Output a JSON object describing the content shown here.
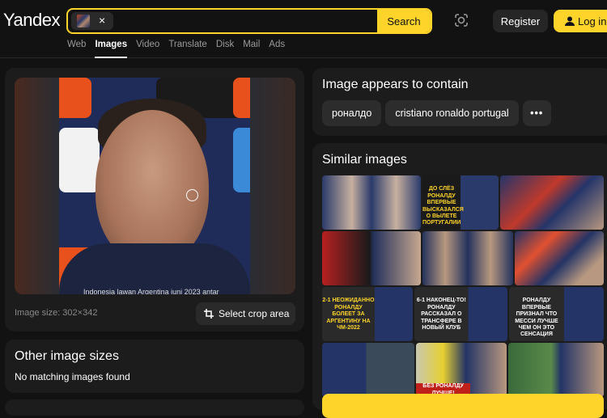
{
  "header": {
    "logo": "Yandex",
    "search_button": "Search",
    "chip_close": "×",
    "register": "Register",
    "login": "Log in"
  },
  "nav": {
    "items": [
      {
        "label": "Web",
        "active": false
      },
      {
        "label": "Images",
        "active": true
      },
      {
        "label": "Video",
        "active": false
      },
      {
        "label": "Translate",
        "active": false
      },
      {
        "label": "Disk",
        "active": false
      },
      {
        "label": "Mail",
        "active": false
      },
      {
        "label": "Ads",
        "active": false
      }
    ]
  },
  "preview": {
    "caption": "Indonesia lawan Argentina juni 2023 antar",
    "image_size": "Image size: 302×342",
    "crop_button": "Select crop area"
  },
  "other_sizes": {
    "title": "Other image sizes",
    "message": "No matching images found"
  },
  "contains": {
    "title": "Image appears to contain",
    "tags": [
      "роналдо",
      "cristiano ronaldo portugal"
    ],
    "more": "•••"
  },
  "similar": {
    "title": "Similar images",
    "rows": [
      [
        {
          "text": "",
          "color": "#2a3a6a"
        },
        {
          "text": "ДО СЛЁЗ РОНАЛДУ ВПЕРВЫЕ ВЫСКАЗАЛСЯ О ВЫЛЕТЕ ПОРТУГАЛИИ",
          "color": "#1a1a1a"
        },
        {
          "text": "",
          "color": "#25356a"
        }
      ],
      [
        {
          "text": "",
          "color": "#2a2f4a"
        },
        {
          "text": "",
          "color": "#24325c"
        },
        {
          "text": "",
          "color": "#243466"
        }
      ],
      [
        {
          "text": "2-1 НЕОЖИДАННО РОНАЛДУ БОЛЕЕТ ЗА АРГЕНТИНУ НА ЧМ-2022",
          "color": "#2a2a2a"
        },
        {
          "text": "6-1 НАКОНЕЦ-ТО! РОНАЛДУ РАССКАЗАЛ О ТРАНСФЕРЕ В НОВЫЙ КЛУБ",
          "color": "#2a2a2a"
        },
        {
          "text": "РОНАЛДУ ВПЕРВЫЕ ПРИЗНАЛ ЧТО МЕССИ ЛУЧШЕ ЧЕМ ОН ЭТО СЕНСАЦИЯ",
          "color": "#2a2a2a"
        }
      ],
      [
        {
          "text": "",
          "color": "#2c3344"
        },
        {
          "text": "БЕЗ РОНАЛДУ ЛУЧШЕ!",
          "color": "#3a3a30"
        },
        {
          "text": "",
          "color": "#3a5a3a"
        }
      ]
    ]
  },
  "colors": {
    "accent": "#fed42b",
    "background": "#121212",
    "card": "#1c1c1c"
  }
}
